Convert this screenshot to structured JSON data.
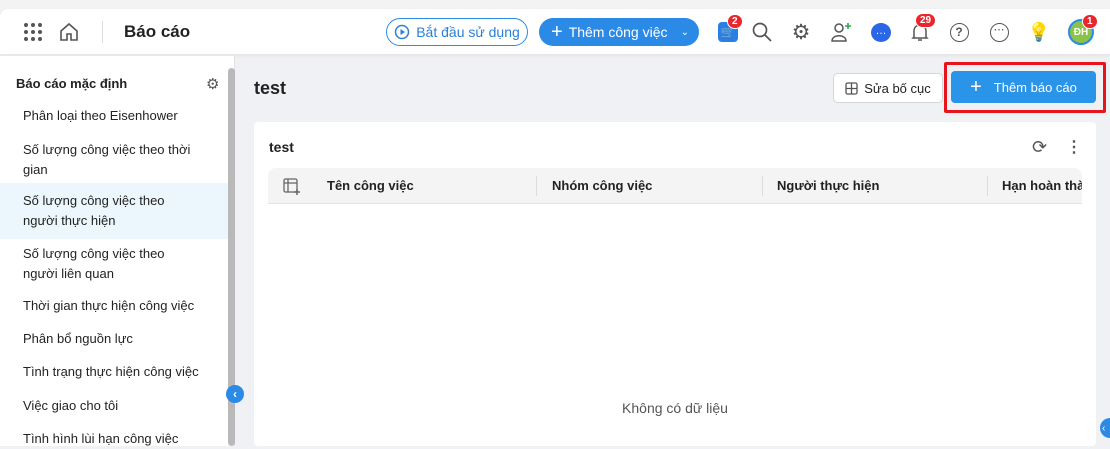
{
  "header": {
    "title": "Báo cáo",
    "start_label": "Bắt đầu sử dụng",
    "add_task_label": "Thêm công việc",
    "cart_badge": "2",
    "notif_badge": "29",
    "avatar_initials": "ĐH",
    "avatar_badge": "1"
  },
  "sidebar": {
    "title": "Báo cáo mặc định",
    "items": [
      {
        "label": "Phân loại theo Eisenhower"
      },
      {
        "label": "Số lượng công việc theo thời gian"
      },
      {
        "label": "Số lượng công việc theo người thực hiện"
      },
      {
        "label": "Số lượng công việc theo người liên quan"
      },
      {
        "label": "Thời gian thực hiện công việc"
      },
      {
        "label": "Phân bổ nguồn lực"
      },
      {
        "label": "Tình trạng thực hiện công việc"
      },
      {
        "label": "Việc giao cho tôi"
      },
      {
        "label": "Tình hình lùi hạn công việc"
      }
    ]
  },
  "main": {
    "title": "test",
    "edit_layout_label": "Sửa bố cục",
    "add_report_label": "Thêm báo cáo",
    "card": {
      "title": "test",
      "columns": [
        "Tên công việc",
        "Nhóm công việc",
        "Người thực hiện",
        "Hạn hoàn thành"
      ],
      "empty": "Không có dữ liệu"
    }
  },
  "colors": {
    "accent": "#2a8ae6",
    "highlight": "#e8141b"
  }
}
